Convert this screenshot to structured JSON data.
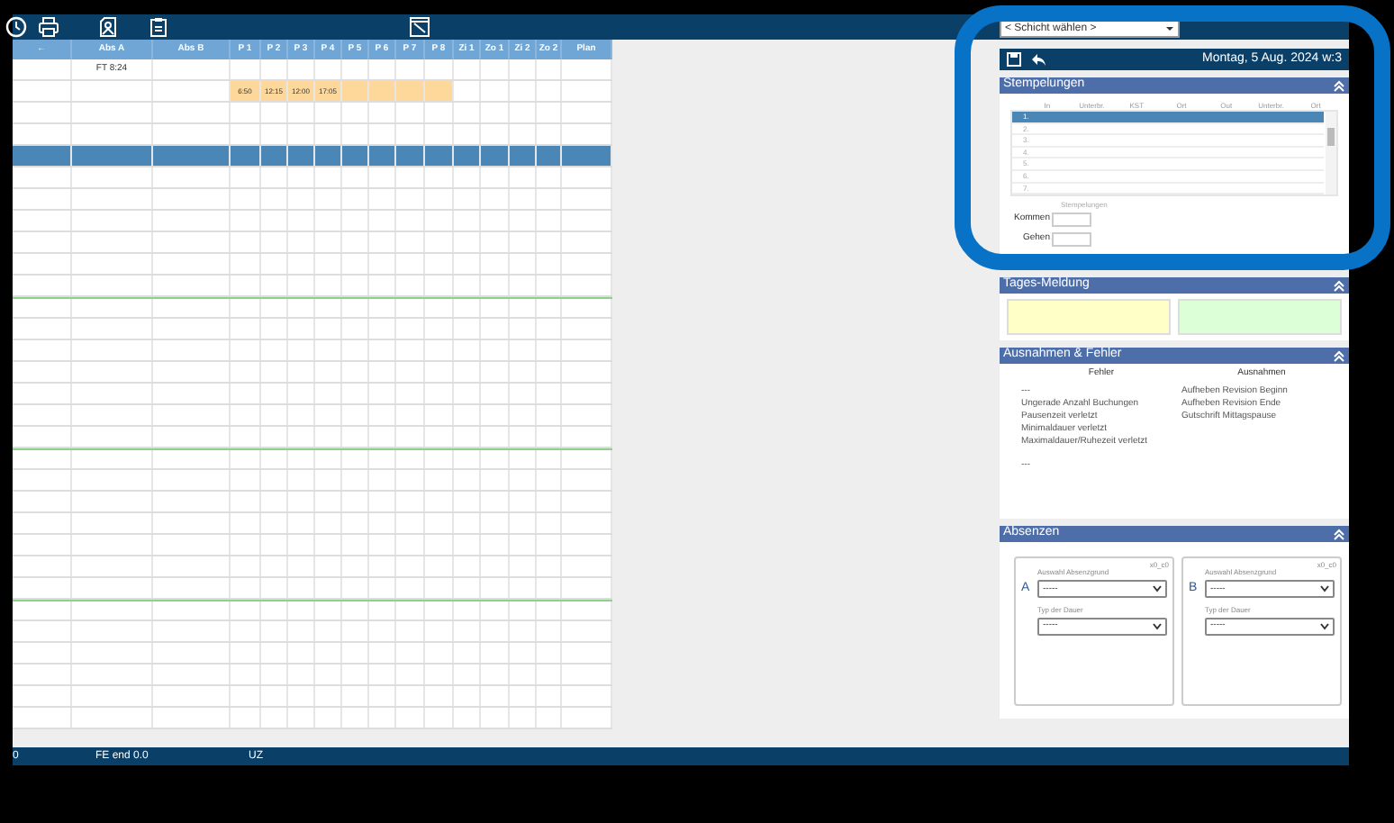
{
  "toolbar": {
    "shift_select": {
      "value": "< Schicht wählen >"
    }
  },
  "table": {
    "columns": [
      "←",
      "Abs A",
      "Abs B",
      "P 1",
      "P 2",
      "P 3",
      "P 4",
      "P 5",
      "P 6",
      "P 7",
      "P 8",
      "Zi 1",
      "Zo 1",
      "Zi 2",
      "Zo 2",
      "Plan"
    ],
    "rows": [
      {
        "selected": false,
        "divider": false,
        "abs_a": "FT 8:24"
      },
      {
        "selected": false,
        "divider": false,
        "punches": [
          "6:50",
          "12:15",
          "12:00",
          "17:05"
        ]
      },
      {
        "selected": false,
        "divider": false
      },
      {
        "selected": false,
        "divider": false
      },
      {
        "selected": true,
        "divider": false
      },
      {
        "selected": false,
        "divider": false
      },
      {
        "selected": false,
        "divider": false
      },
      {
        "selected": false,
        "divider": false
      },
      {
        "selected": false,
        "divider": false
      },
      {
        "selected": false,
        "divider": false
      },
      {
        "selected": false,
        "divider": false
      },
      {
        "selected": false,
        "divider": true
      },
      {
        "selected": false,
        "divider": false
      },
      {
        "selected": false,
        "divider": false
      },
      {
        "selected": false,
        "divider": false
      },
      {
        "selected": false,
        "divider": false
      },
      {
        "selected": false,
        "divider": false
      },
      {
        "selected": false,
        "divider": false
      },
      {
        "selected": false,
        "divider": true
      },
      {
        "selected": false,
        "divider": false
      },
      {
        "selected": false,
        "divider": false
      },
      {
        "selected": false,
        "divider": false
      },
      {
        "selected": false,
        "divider": false
      },
      {
        "selected": false,
        "divider": false
      },
      {
        "selected": false,
        "divider": false
      },
      {
        "selected": false,
        "divider": true
      },
      {
        "selected": false,
        "divider": false
      },
      {
        "selected": false,
        "divider": false
      },
      {
        "selected": false,
        "divider": false
      },
      {
        "selected": false,
        "divider": false
      },
      {
        "selected": false,
        "divider": false
      }
    ]
  },
  "day_panel": {
    "date": "Montag, 5 Aug. 2024 w:3",
    "sections": [
      {
        "kind": "stamps",
        "title": "Stempelungen",
        "columns": [
          "In",
          "Unterbr.",
          "KST",
          "Ort",
          "Out",
          "Unterbr.",
          "Ort"
        ],
        "rows": [
          {
            "label": "1.",
            "selected": true
          },
          {
            "label": "2.",
            "selected": false
          },
          {
            "label": "3.",
            "selected": false
          },
          {
            "label": "4.",
            "selected": false
          },
          {
            "label": "5.",
            "selected": false
          },
          {
            "label": "6.",
            "selected": false
          },
          {
            "label": "7.",
            "selected": false
          }
        ],
        "caption": "Stempelungen",
        "fields": [
          {
            "label": "Kommen"
          },
          {
            "label": "Gehen"
          }
        ]
      },
      {
        "kind": "message",
        "title": "Tages-Meldung",
        "boxes": [
          {
            "color": "#ffffc8"
          },
          {
            "color": "#dcffd8"
          }
        ]
      },
      {
        "kind": "exceptions",
        "title": "Ausnahmen & Fehler",
        "lists": [
          {
            "title": "Fehler",
            "items": [
              "---",
              "Ungerade Anzahl Buchungen",
              "Pausenzeit verletzt",
              "Minimaldauer verletzt",
              "Maximaldauer/Ruhezeit verletzt"
            ],
            "footer": "---"
          },
          {
            "title": "Ausnahmen",
            "items": [
              "Aufheben Revision Beginn",
              "Aufheben Revision Ende",
              "Gutschrift Mittagspause"
            ]
          }
        ]
      },
      {
        "kind": "absences",
        "title": "Absenzen",
        "cards": [
          {
            "letter": "A",
            "code": "x0_c0",
            "fields": [
              {
                "label": "Auswahl Absenzgrund",
                "value": "-----"
              },
              {
                "label": "Typ der Dauer",
                "value": "-----"
              }
            ]
          },
          {
            "letter": "B",
            "code": "x0_c0",
            "fields": [
              {
                "label": "Auswahl Absenzgrund",
                "value": "-----"
              },
              {
                "label": "Typ der Dauer",
                "value": "-----"
              }
            ]
          }
        ]
      }
    ]
  },
  "status_bar": [
    "0",
    "FE end 0.0",
    "UZ"
  ]
}
